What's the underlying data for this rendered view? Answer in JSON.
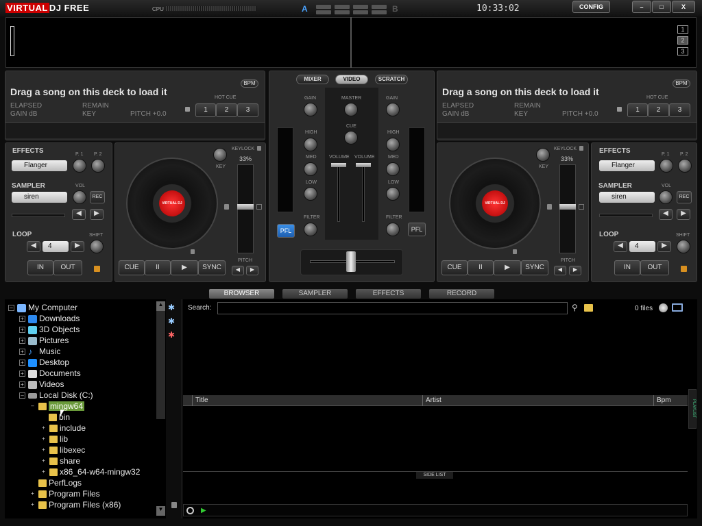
{
  "app": {
    "logo_a": "VIRTUAL",
    "logo_b": "DJ FREE",
    "cpu_label": "CPU",
    "a_label": "A",
    "b_label": "B",
    "clock": "10:33:02",
    "config_label": "CONFIG",
    "minimize": "–",
    "maximize": "□",
    "close": "X"
  },
  "wave": {
    "deck_numbers": [
      "1",
      "2",
      "3"
    ]
  },
  "deck_left": {
    "load_text": "Drag a song on this deck to load it",
    "bpm": "BPM",
    "elapsed": "ELAPSED",
    "gain": "GAIN dB",
    "remain": "REMAIN",
    "key": "KEY",
    "pitch": "PITCH +0.0",
    "hot_cue": "HOT CUE",
    "hot1": "1",
    "hot2": "2",
    "hot3": "3"
  },
  "deck_right": {
    "load_text": "Drag a song on this deck to load it",
    "bpm": "BPM",
    "elapsed": "ELAPSED",
    "gain": "GAIN dB",
    "remain": "REMAIN",
    "key": "KEY",
    "pitch": "PITCH +0.0",
    "hot_cue": "HOT CUE",
    "hot1": "1",
    "hot2": "2",
    "hot3": "3"
  },
  "fx_left": {
    "effects": "EFFECTS",
    "effect_value": "Flanger",
    "p1": "P. 1",
    "p2": "P. 2",
    "sampler": "SAMPLER",
    "sampler_value": "siren",
    "vol": "VOL",
    "rec": "REC",
    "loop": "LOOP",
    "loop_value": "4",
    "shift": "SHIFT",
    "in": "IN",
    "out": "OUT"
  },
  "fx_right": {
    "effects": "EFFECTS",
    "effect_value": "Flanger",
    "p1": "P. 1",
    "p2": "P. 2",
    "sampler": "SAMPLER",
    "sampler_value": "siren",
    "vol": "VOL",
    "rec": "REC",
    "loop": "LOOP",
    "loop_value": "4",
    "shift": "SHIFT",
    "in": "IN",
    "out": "OUT"
  },
  "turn_left": {
    "keylock": "KEYLOCK",
    "keylock_pct": "33%",
    "key": "KEY",
    "pitch": "PITCH",
    "cue": "CUE",
    "pause": "II",
    "play": "▶",
    "sync": "SYNC",
    "label": "VIRTUAL DJ"
  },
  "turn_right": {
    "keylock": "KEYLOCK",
    "keylock_pct": "33%",
    "key": "KEY",
    "pitch": "PITCH",
    "cue": "CUE",
    "pause": "II",
    "play": "▶",
    "sync": "SYNC",
    "label": "VIRTUAL DJ"
  },
  "mixer": {
    "tab_mixer": "MIXER",
    "tab_video": "VIDEO",
    "tab_scratch": "SCRATCH",
    "gain": "GAIN",
    "master": "MASTER",
    "cue": "CUE",
    "high": "HIGH",
    "med": "MED",
    "low": "LOW",
    "volume": "VOLUME",
    "filter": "FILTER",
    "pfl": "PFL"
  },
  "browser": {
    "tabs": [
      "BROWSER",
      "SAMPLER",
      "EFFECTS",
      "RECORD"
    ],
    "search_label": "Search:",
    "files_count": "0 files",
    "col_title": "Title",
    "col_artist": "Artist",
    "col_bpm": "Bpm",
    "side_list": "SIDE LIST",
    "playlist": "PLAYLIST"
  },
  "tree": [
    "My Computer",
    "Downloads",
    "3D Objects",
    "Pictures",
    "Music",
    "Desktop",
    "Documents",
    "Videos",
    "Local Disk (C:)",
    "mingw64",
    "bin",
    "include",
    "lib",
    "libexec",
    "share",
    "x86_64-w64-mingw32",
    "PerfLogs",
    "Program Files",
    "Program Files (x86)"
  ],
  "colors": {
    "accent_red": "#cc0000",
    "accent_blue": "#4aa3ff",
    "pfl_blue": "#1e6fd0"
  }
}
